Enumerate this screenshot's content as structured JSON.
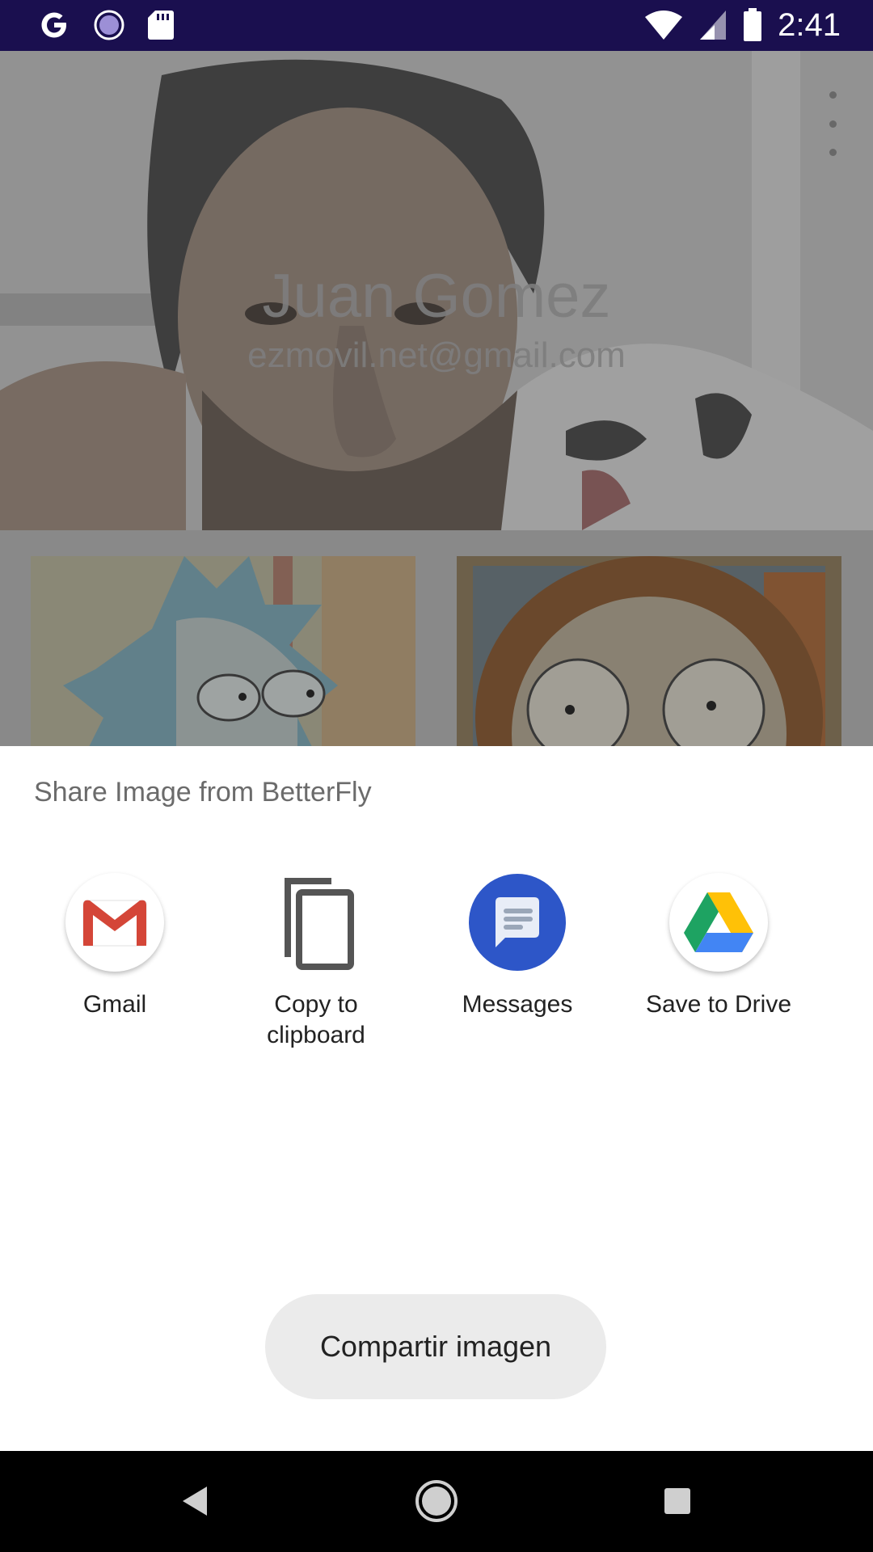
{
  "status_bar": {
    "time": "2:41",
    "left_icons": [
      "google-icon",
      "sync-icon",
      "sd-card-icon"
    ],
    "right_icons": [
      "wifi-icon",
      "signal-icon",
      "battery-icon"
    ]
  },
  "profile": {
    "name": "Juan Gomez",
    "email": "ezmovil.net@gmail.com"
  },
  "share_sheet": {
    "title": "Share Image from BetterFly",
    "targets": [
      {
        "label": "Gmail",
        "icon": "gmail-icon"
      },
      {
        "label": "Copy to\nclipboard",
        "icon": "copy-icon"
      },
      {
        "label": "Messages",
        "icon": "messages-icon"
      },
      {
        "label": "Save to Drive",
        "icon": "drive-icon"
      }
    ]
  },
  "toast": {
    "text": "Compartir imagen"
  },
  "colors": {
    "status_bar": "#1a0f4f",
    "messages_blue": "#2d56c8",
    "gmail_red": "#d44638",
    "drive_green": "#1ea362",
    "drive_yellow": "#ffc107",
    "drive_blue": "#4285f4"
  },
  "nav_bar": {
    "buttons": [
      "back-icon",
      "home-icon",
      "recents-icon"
    ]
  }
}
